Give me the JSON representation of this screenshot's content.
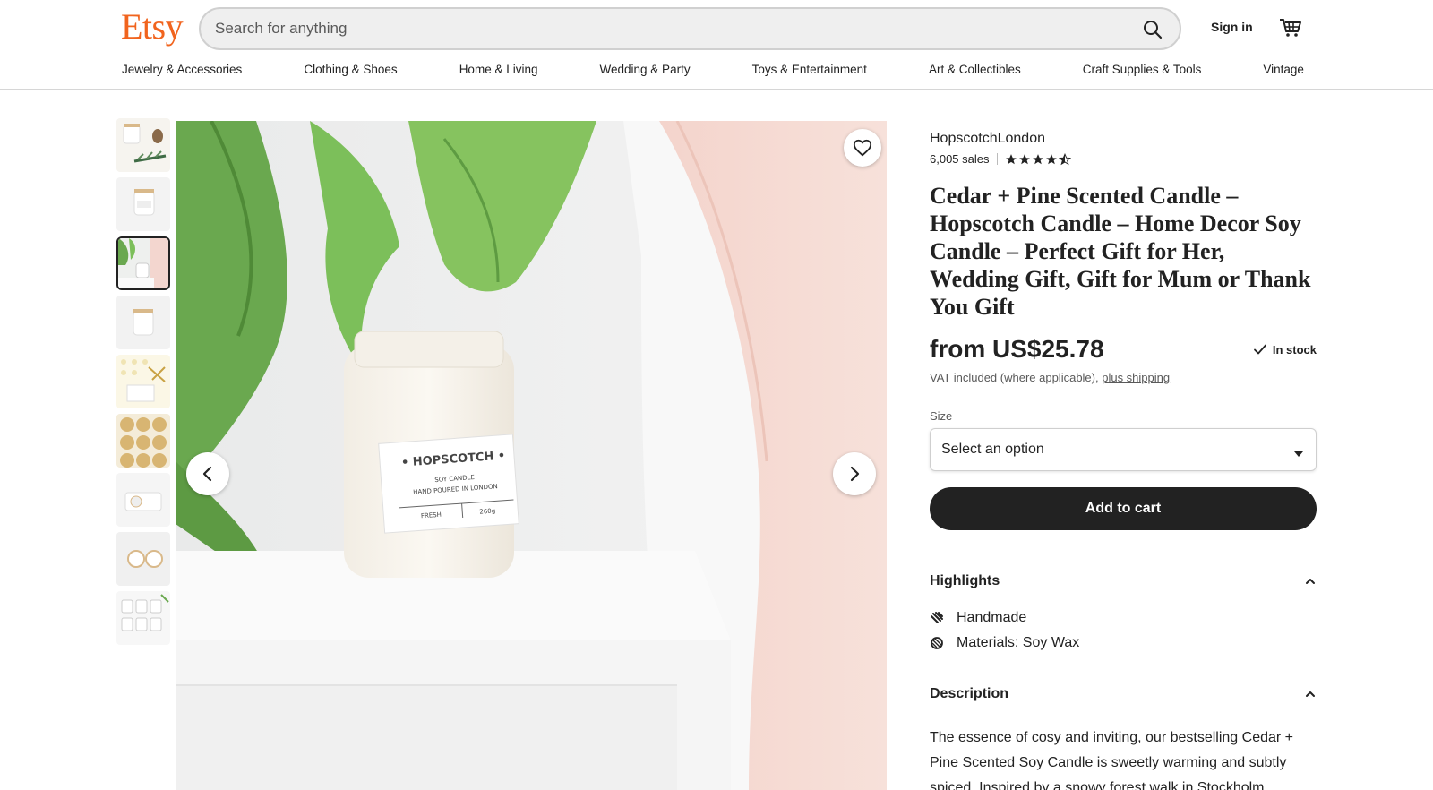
{
  "header": {
    "logo": "Etsy",
    "search_placeholder": "Search for anything",
    "signin_label": "Sign in",
    "nav": [
      "Jewelry & Accessories",
      "Clothing & Shoes",
      "Home & Living",
      "Wedding & Party",
      "Toys & Entertainment",
      "Art & Collectibles",
      "Craft Supplies & Tools",
      "Vintage"
    ]
  },
  "gallery": {
    "thumbnail_count": 9,
    "active_thumbnail": 3,
    "main_image_text": {
      "brand": "• HOPSCOTCH •",
      "line1": "SOY CANDLE",
      "line2": "HAND POURED IN LONDON",
      "scent": "FRESH",
      "weight": "260g"
    }
  },
  "listing": {
    "shop_name": "HopscotchLondon",
    "sales": "6,005 sales",
    "rating": 4.5,
    "title": "Cedar + Pine Scented Candle – Hopscotch Candle – Home Decor Soy Candle – Perfect Gift for Her, Wedding Gift, Gift for Mum or Thank You Gift",
    "price": "from US$25.78",
    "stock": "In stock",
    "vat_text": "VAT included (where applicable), ",
    "shipping_link": "plus shipping",
    "size_label": "Size",
    "size_value": "Select an option",
    "add_to_cart": "Add to cart",
    "highlights_title": "Highlights",
    "highlights": [
      "Handmade",
      "Materials: Soy Wax"
    ],
    "description_title": "Description",
    "description": "The essence of cosy and inviting, our bestselling Cedar + Pine Scented Soy Candle is sweetly warming and subtly spiced. Inspired by a snowy forest walk in Stockholm, stumbling across a hidden bakery and"
  },
  "colors": {
    "brand": "#f1641e",
    "button_dark": "#222222",
    "text": "#222222"
  }
}
